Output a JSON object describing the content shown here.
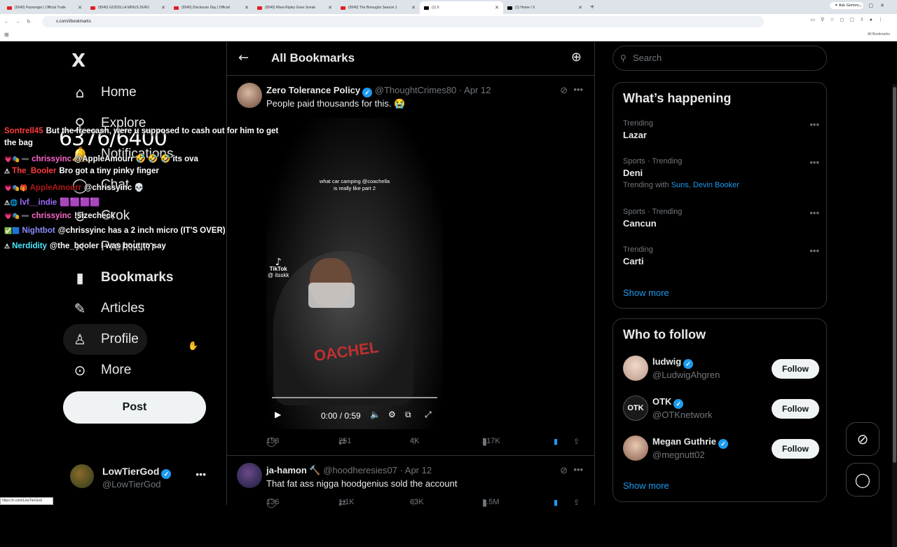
{
  "browser": {
    "tabs": [
      {
        "label": "(9540) Passenger | Official Traile",
        "kind": "yt"
      },
      {
        "label": "(9540) GODZILLA MINUS ZERO",
        "kind": "yt"
      },
      {
        "label": "(9540) Disclosure Day | Official",
        "kind": "yt"
      },
      {
        "label": "(9540) Rhea Ripley Goes Sneak",
        "kind": "yt"
      },
      {
        "label": "(9540) The Boroughs Season 1",
        "kind": "yt"
      },
      {
        "label": "(1) X",
        "kind": "x",
        "active": true
      },
      {
        "label": "(1) Home / X",
        "kind": "x"
      }
    ],
    "new_tab": "+",
    "ask_gemini": "✦ Ask Gemini",
    "url": "x.com/i/bookmarks",
    "all_bookmarks": "All Bookmarks"
  },
  "nav": {
    "logo": "X",
    "items": [
      {
        "label": "Home",
        "icon": "home-icon",
        "glyph": "⌂"
      },
      {
        "label": "Explore",
        "icon": "search-icon",
        "glyph": "⚲"
      },
      {
        "label": "Notifications",
        "icon": "bell-icon",
        "glyph": "🔔"
      },
      {
        "label": "Chat",
        "icon": "chat-icon",
        "glyph": "◯"
      },
      {
        "label": "Grok",
        "icon": "grok-icon",
        "glyph": "⊘"
      },
      {
        "label": "Premium",
        "icon": "premium-icon",
        "glyph": "✕"
      },
      {
        "label": "Bookmarks",
        "icon": "bookmark-icon",
        "glyph": "▮"
      },
      {
        "label": "Articles",
        "icon": "articles-icon",
        "glyph": "✎"
      },
      {
        "label": "Profile",
        "icon": "profile-icon",
        "glyph": "♙"
      },
      {
        "label": "More",
        "icon": "more-icon",
        "glyph": "⊙"
      }
    ],
    "post_label": "Post",
    "account": {
      "name": "LowTierGod",
      "handle": "@LowTierGod"
    }
  },
  "main": {
    "title": "All Bookmarks",
    "tweets": [
      {
        "name": "Zero Tolerance Policy",
        "handle": "@ThoughtCrimes80",
        "date": "· Apr 12",
        "text": "People paid thousands for this. 😭",
        "video": {
          "caption_line1": "what car camping @coachella",
          "caption_line2": "is really like part 2",
          "tiktok": "TikTok",
          "tiktok_user": "@ itsskk",
          "shirt_text": "OACHEL",
          "time": "0:00 / 0:59"
        },
        "replies": "158",
        "reposts": "251",
        "likes": "4K",
        "views": "217K"
      },
      {
        "name": "ja-hamon 🔨",
        "handle": "@hoodheresies07",
        "date": "· Apr 12",
        "text": "That fat ass nigga hoodgenius sold the account",
        "replies": "136",
        "reposts": "1.1K",
        "likes": "63K",
        "views": "1.5M"
      }
    ]
  },
  "sidebar": {
    "search_placeholder": "Search",
    "happening_title": "What’s happening",
    "trends": [
      {
        "category": "Trending",
        "title": "Lazar"
      },
      {
        "category": "Sports · Trending",
        "title": "Deni",
        "with_prefix": "Trending with",
        "with_links": "Suns, Devin Booker"
      },
      {
        "category": "Sports · Trending",
        "title": "Cancun"
      },
      {
        "category": "Trending",
        "title": "Carti"
      }
    ],
    "show_more": "Show more",
    "who_title": "Who to follow",
    "who": [
      {
        "name": "ludwig",
        "handle": "@LudwigAhgren"
      },
      {
        "name": "OTK",
        "handle": "@OTKnetwork"
      },
      {
        "name": "Megan Guthrie",
        "handle": "@megnutt02"
      }
    ],
    "follow_label": "Follow"
  },
  "overlay": {
    "counter": "6376/6400",
    "chat": [
      {
        "user": "Sontrell45",
        "color": "#ff3b3b",
        "msg": "But the freecash, were u supposed to cash out for him to get",
        "badges": ""
      },
      {
        "user": "",
        "color": "#ffffff",
        "msg": "the bag",
        "badges": ""
      },
      {
        "user": "chrissyinc",
        "color": "#ff66cc",
        "msg": "@AppleAmourr 🤣 🤣 🤣 its ova",
        "badges": "💗🎭 ➖"
      },
      {
        "user": "The_Booler",
        "color": "#ff3b3b",
        "msg": "Bro got a tiny pinky finger",
        "badges": "⚠"
      },
      {
        "user": "AppleAmourr",
        "color": "#b01818",
        "msg": "@chrissyinc 💀",
        "badges": "💗🎭🎁"
      },
      {
        "user": "lvf__indie",
        "color": "#9b6bff",
        "msg": "🟪🟪🟪🟪",
        "badges": "⚠🌐"
      },
      {
        "user": "chrissyinc",
        "color": "#ff66cc",
        "msg": "!sizecheck",
        "badges": "💗🎭 ➖"
      },
      {
        "user": "Nightbot",
        "color": "#8c8cff",
        "msg": "@chrissyinc has a 2 inch micro (IT'S OVER)",
        "badges": "✅🟦"
      },
      {
        "user": "Nerdidity",
        "color": "#4de8ff",
        "msg": "@the_booler I was bout to say",
        "badges": "⚠"
      }
    ],
    "status_url": "https://x.com/LowTierGod"
  }
}
